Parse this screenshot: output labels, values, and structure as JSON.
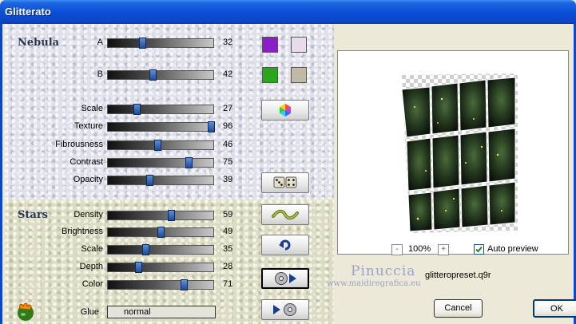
{
  "window": {
    "title": "Glitterato"
  },
  "nebula": {
    "section_title": "Nebula",
    "sliders": [
      {
        "label": "A",
        "value": "32",
        "position": 0.32
      },
      {
        "label": "B",
        "value": "42",
        "position": 0.42
      },
      {
        "label": "Scale",
        "value": "27",
        "position": 0.27
      },
      {
        "label": "Texture",
        "value": "96",
        "position": 0.96
      },
      {
        "label": "Fibrousness",
        "value": "46",
        "position": 0.46
      },
      {
        "label": "Contrast",
        "value": "75",
        "position": 0.75
      },
      {
        "label": "Opacity",
        "value": "39",
        "position": 0.39
      }
    ],
    "swatches": {
      "a_color": "#8a1fc8",
      "a_alt": "#e8dcec",
      "b_color": "#2aa61c",
      "b_alt": "#c2b8a6"
    }
  },
  "stars": {
    "section_title": "Stars",
    "sliders": [
      {
        "label": "Density",
        "value": "59",
        "position": 0.59
      },
      {
        "label": "Brightness",
        "value": "49",
        "position": 0.49
      },
      {
        "label": "Scale",
        "value": "35",
        "position": 0.35
      },
      {
        "label": "Depth",
        "value": "28",
        "position": 0.28
      },
      {
        "label": "Color",
        "value": "71",
        "position": 0.71
      }
    ]
  },
  "glue": {
    "label": "Glue",
    "value": "normal"
  },
  "preview": {
    "zoom_out": "-",
    "zoom_in": "+",
    "zoom_level": "100%",
    "auto_preview_label": "Auto preview",
    "auto_preview_checked": true
  },
  "watermark": {
    "name": "Pinuccia",
    "url": "www.maidiregrafica.eu"
  },
  "preset": {
    "filename": "glitteropreset.q9r"
  },
  "buttons": {
    "cancel": "Cancel",
    "ok": "OK"
  }
}
